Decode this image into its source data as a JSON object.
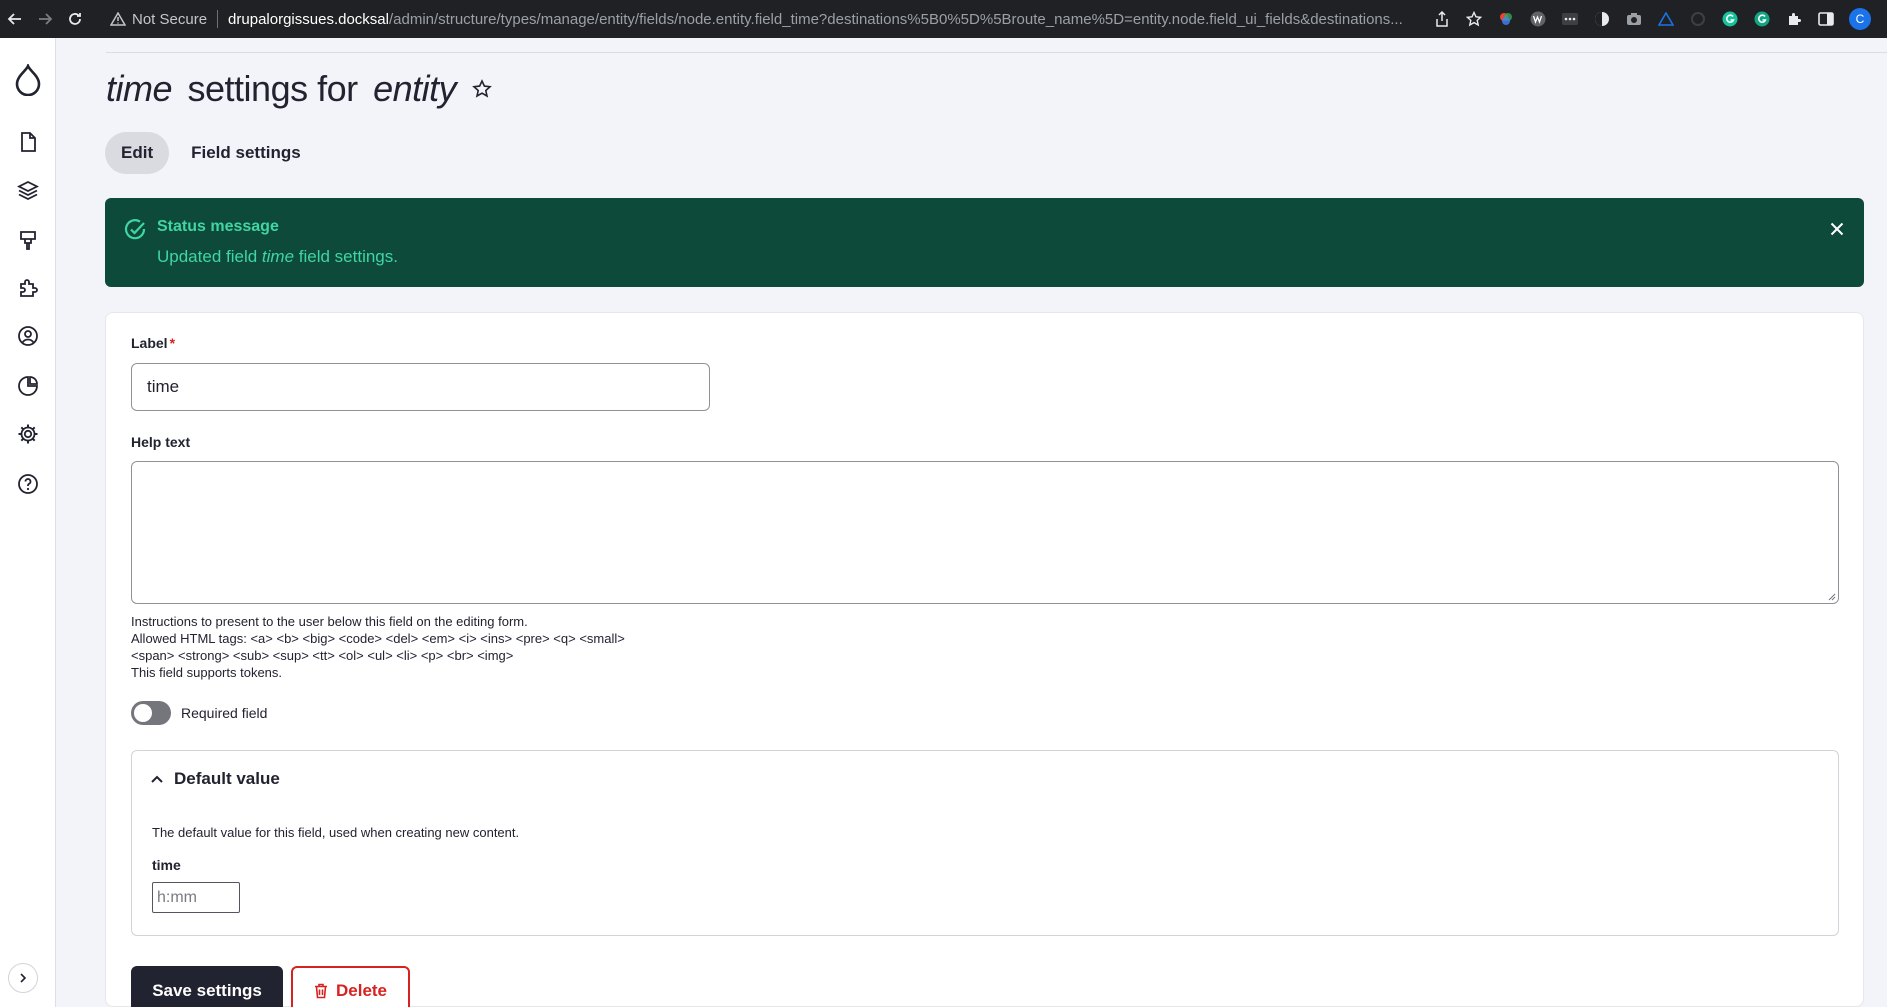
{
  "browser": {
    "security": "Not Secure",
    "host": "drupalorgissues.docksal",
    "path": "/admin/structure/types/manage/entity/fields/node.entity.field_time?destinations%5B0%5D%5Broute_name%5D=entity.node.field_ui_fields&destinations...",
    "profile_initial": "C"
  },
  "page": {
    "title_field": "time",
    "title_middle": " settings for ",
    "title_entity": "entity"
  },
  "tabs": [
    {
      "label": "Edit",
      "active": true
    },
    {
      "label": "Field settings",
      "active": false
    }
  ],
  "status": {
    "title": "Status message",
    "body_prefix": "Updated field ",
    "body_field": "time",
    "body_suffix": " field settings."
  },
  "form": {
    "label_label": "Label",
    "label_required_mark": "*",
    "label_value": "time",
    "help_label": "Help text",
    "help_value": "",
    "help_desc": [
      "Instructions to present to the user below this field on the editing form.",
      "Allowed HTML tags: <a> <b> <big> <code> <del> <em> <i> <ins> <pre> <q> <small>",
      "<span> <strong> <sub> <sup> <tt> <ol> <ul> <li> <p> <br> <img>",
      "This field supports tokens."
    ],
    "required_label": "Required field",
    "required_on": false,
    "default_value": {
      "summary": "Default value",
      "description": "The default value for this field, used when creating new content.",
      "time_label": "time",
      "time_placeholder": "h:mm"
    },
    "save_label": "Save settings",
    "delete_label": "Delete"
  },
  "colors": {
    "status_bg": "#0d4a3a",
    "status_text": "#40d5a2",
    "primary": "#222330",
    "danger": "#d72222"
  }
}
